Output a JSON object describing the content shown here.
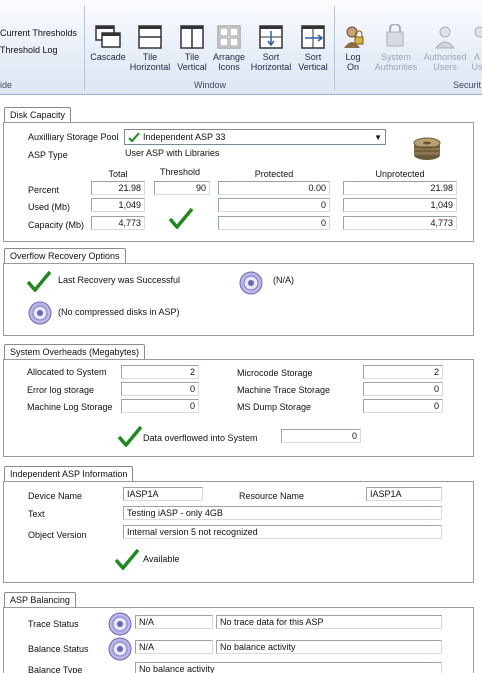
{
  "ribbon": {
    "left_links": [
      "Current Thresholds",
      "Threshold Log"
    ],
    "left_group": "ide",
    "window_group": "Window",
    "security_group": "Securit",
    "buttons": [
      {
        "line1": "Cascade",
        "line2": "",
        "icon": "cascade-icon"
      },
      {
        "line1": "Tile",
        "line2": "Horizontal",
        "icon": "tile-horizontal-icon"
      },
      {
        "line1": "Tile",
        "line2": "Vertical",
        "icon": "tile-vertical-icon"
      },
      {
        "line1": "Arrange",
        "line2": "Icons",
        "icon": "arrange-icons-icon"
      },
      {
        "line1": "Sort",
        "line2": "Horizontal",
        "icon": "sort-horizontal-icon"
      },
      {
        "line1": "Sort",
        "line2": "Vertical",
        "icon": "sort-vertical-icon"
      },
      {
        "line1": "Log",
        "line2": "On",
        "icon": "log-on-icon"
      },
      {
        "line1": "System",
        "line2": "Authorities",
        "icon": "system-authorities-icon"
      },
      {
        "line1": "Authorised",
        "line2": "Users",
        "icon": "authorised-users-icon"
      },
      {
        "line1": "A",
        "line2": "Us",
        "icon": "user-icon"
      }
    ]
  },
  "disk_capacity": {
    "tab": "Disk Capacity",
    "pool_label": "Auxilliary Storage Pool",
    "pool_value": "Independent ASP 33",
    "asp_type_label": "ASP Type",
    "asp_type_value": "User ASP with Libraries",
    "col_total": "Total",
    "col_threshold": "Threshold",
    "col_protected": "Protected",
    "col_unprotected": "Unprotected",
    "row_percent": "Percent",
    "row_used": "Used (Mb)",
    "row_capacity": "Capacity (Mb)",
    "percent_total": "21.98",
    "percent_threshold": "90",
    "percent_protected": "0.00",
    "percent_unprotected": "21.98",
    "used_total": "1,049",
    "used_protected": "0",
    "used_unprotected": "1,049",
    "capacity_total": "4,773",
    "capacity_protected": "0",
    "capacity_unprotected": "4,773"
  },
  "overflow": {
    "tab": "Overflow Recovery Options",
    "last_recovery": "Last Recovery was Successful",
    "na": "(N/A)",
    "no_compressed": "(No compressed disks in ASP)"
  },
  "overheads": {
    "tab": "System Overheads (Megabytes)",
    "allocated_label": "Allocated to System",
    "allocated_value": "2",
    "error_log_label": "Error log storage",
    "error_log_value": "0",
    "machine_log_label": "Machine Log Storage",
    "machine_log_value": "0",
    "microcode_label": "Microcode Storage",
    "microcode_value": "2",
    "machine_trace_label": "Machine Trace Storage",
    "machine_trace_value": "0",
    "ms_dump_label": "MS Dump Storage",
    "ms_dump_value": "0",
    "overflowed_label": "Data overflowed into System",
    "overflowed_value": "0"
  },
  "iasp": {
    "tab": "Independent ASP Information",
    "device_label": "Device Name",
    "device_value": "IASP1A",
    "resource_label": "Resource Name",
    "resource_value": "IASP1A",
    "text_label": "Text",
    "text_value": "Testing iASP - only 4GB",
    "version_label": "Object Version",
    "version_value": "Internal version 5 not recognized",
    "available": "Available"
  },
  "balancing": {
    "tab": "ASP Balancing",
    "trace_label": "Trace Status",
    "trace_value": "N/A",
    "trace_desc": "No trace data for this ASP",
    "balance_label": "Balance Status",
    "balance_value": "N/A",
    "balance_desc": "No balance activity",
    "type_label": "Balance Type",
    "type_value": "No balance activity"
  }
}
